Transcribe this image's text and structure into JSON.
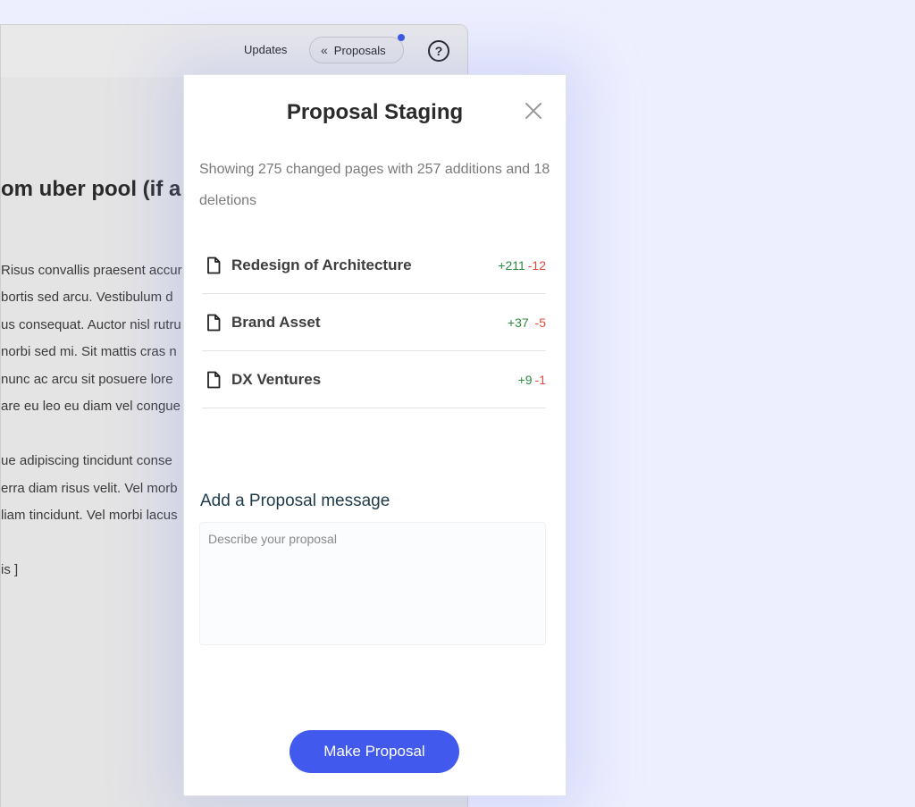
{
  "background": {
    "topbar": {
      "updates_label": "Updates",
      "proposals_label": "Proposals",
      "help_label": "?"
    },
    "document": {
      "heading": "om uber pool (if a",
      "lines": [
        "Risus convallis praesent accur",
        "bortis sed arcu. Vestibulum d",
        "us consequat. Auctor nisl rutru",
        "norbi sed mi. Sit mattis cras n",
        "nunc ac arcu sit posuere lore",
        "are eu leo eu diam vel congue",
        "ue adipiscing tincidunt conse",
        "erra diam risus velit. Vel morb",
        "liam tincidunt. Vel morbi lacus",
        "is ]"
      ]
    }
  },
  "modal": {
    "title": "Proposal Staging",
    "summary": "Showing 275 changed pages with 257 additions and 18 deletions",
    "changes": [
      {
        "name": "Redesign of Architecture",
        "additions": "+211",
        "deletions": "-12"
      },
      {
        "name": "Brand Asset",
        "additions": "+37",
        "deletions": "-5"
      },
      {
        "name": "DX Ventures",
        "additions": "+9",
        "deletions": "-1"
      }
    ],
    "message_label": "Add a Proposal message",
    "message_placeholder": "Describe your proposal",
    "message_value": "",
    "submit_label": "Make Proposal"
  },
  "colors": {
    "accent": "#4159ec",
    "additions": "#2d8a3e",
    "deletions": "#e04b3c",
    "notification_dot": "#3a55e6"
  }
}
